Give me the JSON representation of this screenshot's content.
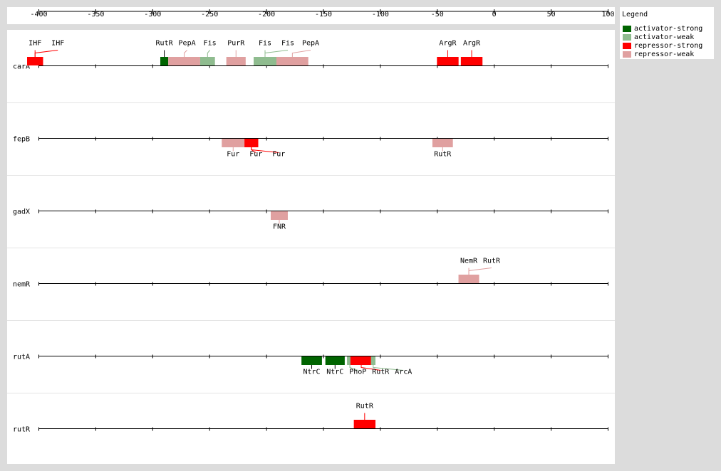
{
  "legend": {
    "title": "Legend",
    "items": [
      {
        "label": "activator-strong",
        "color": "#006400"
      },
      {
        "label": "activator-weak",
        "color": "#8fbc8f"
      },
      {
        "label": "repressor-strong",
        "color": "#ff0000"
      },
      {
        "label": "repressor-weak",
        "color": "#e0a0a0"
      }
    ]
  },
  "chart_data": {
    "type": "diagram",
    "axis": {
      "min": -410,
      "max": 100,
      "ticks": [
        -400,
        -350,
        -300,
        -250,
        -200,
        -150,
        -100,
        -50,
        0,
        50,
        100
      ]
    },
    "genes": [
      {
        "name": "carA",
        "sites": [
          {
            "label": "IHF",
            "start": -410,
            "end": -396,
            "kind": "repressor-strong",
            "label_pos": "above"
          },
          {
            "label": "IHF",
            "start": -410,
            "end": -396,
            "kind": "repressor-strong",
            "label_pos": "above"
          },
          {
            "label": "RutR",
            "start": -293,
            "end": -286,
            "kind": "activator-strong",
            "label_pos": "above"
          },
          {
            "label": "PepA",
            "start": -286,
            "end": -258,
            "kind": "repressor-weak",
            "label_pos": "above"
          },
          {
            "label": "Fis",
            "start": -258,
            "end": -245,
            "kind": "activator-weak",
            "label_pos": "above"
          },
          {
            "label": "PurR",
            "start": -235,
            "end": -218,
            "kind": "repressor-weak",
            "label_pos": "above"
          },
          {
            "label": "Fis",
            "start": -211,
            "end": -191,
            "kind": "activator-weak",
            "label_pos": "above"
          },
          {
            "label": "Fis",
            "start": -211,
            "end": -191,
            "kind": "activator-weak",
            "label_pos": "above"
          },
          {
            "label": "PepA",
            "start": -191,
            "end": -163,
            "kind": "repressor-weak",
            "label_pos": "above"
          },
          {
            "label": "ArgR",
            "start": -50,
            "end": -31,
            "kind": "repressor-strong",
            "label_pos": "above"
          },
          {
            "label": "ArgR",
            "start": -29,
            "end": -10,
            "kind": "repressor-strong",
            "label_pos": "above"
          }
        ]
      },
      {
        "name": "fepB",
        "sites": [
          {
            "label": "Fur",
            "start": -239,
            "end": -219,
            "kind": "repressor-weak",
            "label_pos": "below"
          },
          {
            "label": "Fur",
            "start": -219,
            "end": -207,
            "kind": "repressor-strong",
            "label_pos": "below"
          },
          {
            "label": "Fur",
            "start": -219,
            "end": -207,
            "kind": "repressor-strong",
            "label_pos": "below"
          },
          {
            "label": "RutR",
            "start": -54,
            "end": -36,
            "kind": "repressor-weak",
            "label_pos": "below"
          }
        ]
      },
      {
        "name": "gadX",
        "sites": [
          {
            "label": "FNR",
            "start": -196,
            "end": -181,
            "kind": "repressor-weak",
            "label_pos": "below"
          }
        ]
      },
      {
        "name": "nemR",
        "sites": [
          {
            "label": "NemR",
            "start": -31,
            "end": -13,
            "kind": "repressor-weak",
            "label_pos": "above"
          },
          {
            "label": "RutR",
            "start": -31,
            "end": -13,
            "kind": "repressor-weak",
            "label_pos": "above"
          }
        ]
      },
      {
        "name": "rutA",
        "sites": [
          {
            "label": "NtrC",
            "start": -169,
            "end": -151,
            "kind": "activator-strong",
            "label_pos": "below"
          },
          {
            "label": "NtrC",
            "start": -148,
            "end": -131,
            "kind": "activator-strong",
            "label_pos": "below"
          },
          {
            "label": "PhoP",
            "start": -129,
            "end": -124,
            "kind": "activator-weak",
            "label_pos": "below"
          },
          {
            "label": "RutR",
            "start": -126,
            "end": -107,
            "kind": "repressor-strong",
            "label_pos": "below"
          },
          {
            "label": "ArcA",
            "start": -108,
            "end": -104,
            "kind": "activator-weak",
            "label_pos": "below"
          }
        ]
      },
      {
        "name": "rutR",
        "sites": [
          {
            "label": "RutR",
            "start": -123,
            "end": -104,
            "kind": "repressor-strong",
            "label_pos": "above"
          }
        ]
      }
    ]
  }
}
